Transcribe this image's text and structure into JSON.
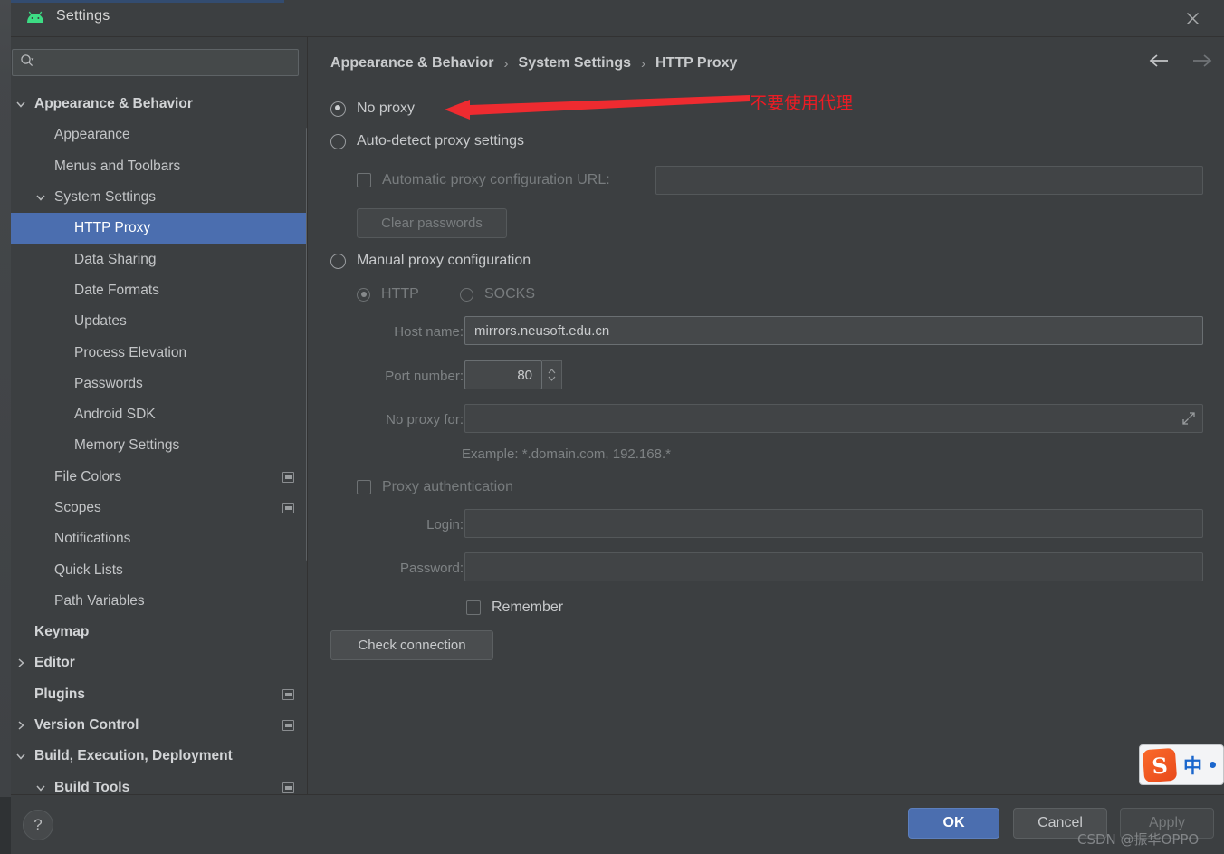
{
  "window": {
    "title": "Settings",
    "logo_icon": "android-logo-icon",
    "close_icon": "close-icon"
  },
  "sidebar": {
    "search": {
      "placeholder": "",
      "value": "",
      "icon": "search-icon"
    },
    "items": [
      {
        "label": "Appearance & Behavior",
        "indent": 0,
        "arrow": "down",
        "bold": true,
        "selected": false,
        "badge": false
      },
      {
        "label": "Appearance",
        "indent": 1,
        "arrow": "",
        "bold": false,
        "selected": false,
        "badge": false
      },
      {
        "label": "Menus and Toolbars",
        "indent": 1,
        "arrow": "",
        "bold": false,
        "selected": false,
        "badge": false
      },
      {
        "label": "System Settings",
        "indent": 1,
        "arrow": "down",
        "bold": false,
        "selected": false,
        "badge": false
      },
      {
        "label": "HTTP Proxy",
        "indent": 2,
        "arrow": "",
        "bold": false,
        "selected": true,
        "badge": false
      },
      {
        "label": "Data Sharing",
        "indent": 2,
        "arrow": "",
        "bold": false,
        "selected": false,
        "badge": false
      },
      {
        "label": "Date Formats",
        "indent": 2,
        "arrow": "",
        "bold": false,
        "selected": false,
        "badge": false
      },
      {
        "label": "Updates",
        "indent": 2,
        "arrow": "",
        "bold": false,
        "selected": false,
        "badge": false
      },
      {
        "label": "Process Elevation",
        "indent": 2,
        "arrow": "",
        "bold": false,
        "selected": false,
        "badge": false
      },
      {
        "label": "Passwords",
        "indent": 2,
        "arrow": "",
        "bold": false,
        "selected": false,
        "badge": false
      },
      {
        "label": "Android SDK",
        "indent": 2,
        "arrow": "",
        "bold": false,
        "selected": false,
        "badge": false
      },
      {
        "label": "Memory Settings",
        "indent": 2,
        "arrow": "",
        "bold": false,
        "selected": false,
        "badge": false
      },
      {
        "label": "File Colors",
        "indent": 1,
        "arrow": "",
        "bold": false,
        "selected": false,
        "badge": true
      },
      {
        "label": "Scopes",
        "indent": 1,
        "arrow": "",
        "bold": false,
        "selected": false,
        "badge": true
      },
      {
        "label": "Notifications",
        "indent": 1,
        "arrow": "",
        "bold": false,
        "selected": false,
        "badge": false
      },
      {
        "label": "Quick Lists",
        "indent": 1,
        "arrow": "",
        "bold": false,
        "selected": false,
        "badge": false
      },
      {
        "label": "Path Variables",
        "indent": 1,
        "arrow": "",
        "bold": false,
        "selected": false,
        "badge": false
      },
      {
        "label": "Keymap",
        "indent": 0,
        "arrow": "",
        "bold": true,
        "selected": false,
        "badge": false
      },
      {
        "label": "Editor",
        "indent": 0,
        "arrow": "right",
        "bold": true,
        "selected": false,
        "badge": false
      },
      {
        "label": "Plugins",
        "indent": 0,
        "arrow": "",
        "bold": true,
        "selected": false,
        "badge": true
      },
      {
        "label": "Version Control",
        "indent": 0,
        "arrow": "right",
        "bold": true,
        "selected": false,
        "badge": true
      },
      {
        "label": "Build, Execution, Deployment",
        "indent": 0,
        "arrow": "down",
        "bold": true,
        "selected": false,
        "badge": false
      },
      {
        "label": "Build Tools",
        "indent": 1,
        "arrow": "down",
        "bold": true,
        "selected": false,
        "badge": true
      }
    ]
  },
  "breadcrumb": {
    "items": [
      "Appearance & Behavior",
      "System Settings",
      "HTTP Proxy"
    ],
    "separator": "›",
    "back_icon": "arrow-left-icon",
    "forward_icon": "arrow-right-icon"
  },
  "proxy": {
    "no_proxy_label": "No proxy",
    "auto_detect_label": "Auto-detect proxy settings",
    "auto_config_url_label": "Automatic proxy configuration URL:",
    "auto_config_url_value": "",
    "clear_passwords_label": "Clear passwords",
    "manual_label": "Manual proxy configuration",
    "http_label": "HTTP",
    "socks_label": "SOCKS",
    "host_name_label": "Host name:",
    "host_name_value": "mirrors.neusoft.edu.cn",
    "port_number_label": "Port number:",
    "port_number_value": "80",
    "no_proxy_for_label": "No proxy for:",
    "no_proxy_for_value": "",
    "example_text": "Example: *.domain.com, 192.168.*",
    "expand_icon": "expand-icon",
    "proxy_auth_label": "Proxy authentication",
    "login_label": "Login:",
    "login_value": "",
    "password_label": "Password:",
    "password_value": "",
    "remember_label": "Remember",
    "check_connection_label": "Check connection"
  },
  "footer": {
    "help_label": "?",
    "ok_label": "OK",
    "cancel_label": "Cancel",
    "apply_label": "Apply"
  },
  "annotation": {
    "text": "不要使用代理",
    "color": "#ec1c24",
    "arrow_icon": "red-arrow-left-icon"
  },
  "ime": {
    "logo_letter": "S",
    "mode_label": "中",
    "dot_icon": "dot-icon"
  },
  "watermark": {
    "text": "CSDN @振华OPPO"
  },
  "colors": {
    "background": "#3c3f41",
    "selection": "#4b6eaf",
    "accent_red": "#ec1c24",
    "text_primary": "#c8cacc",
    "text_disabled": "#7e8284"
  }
}
